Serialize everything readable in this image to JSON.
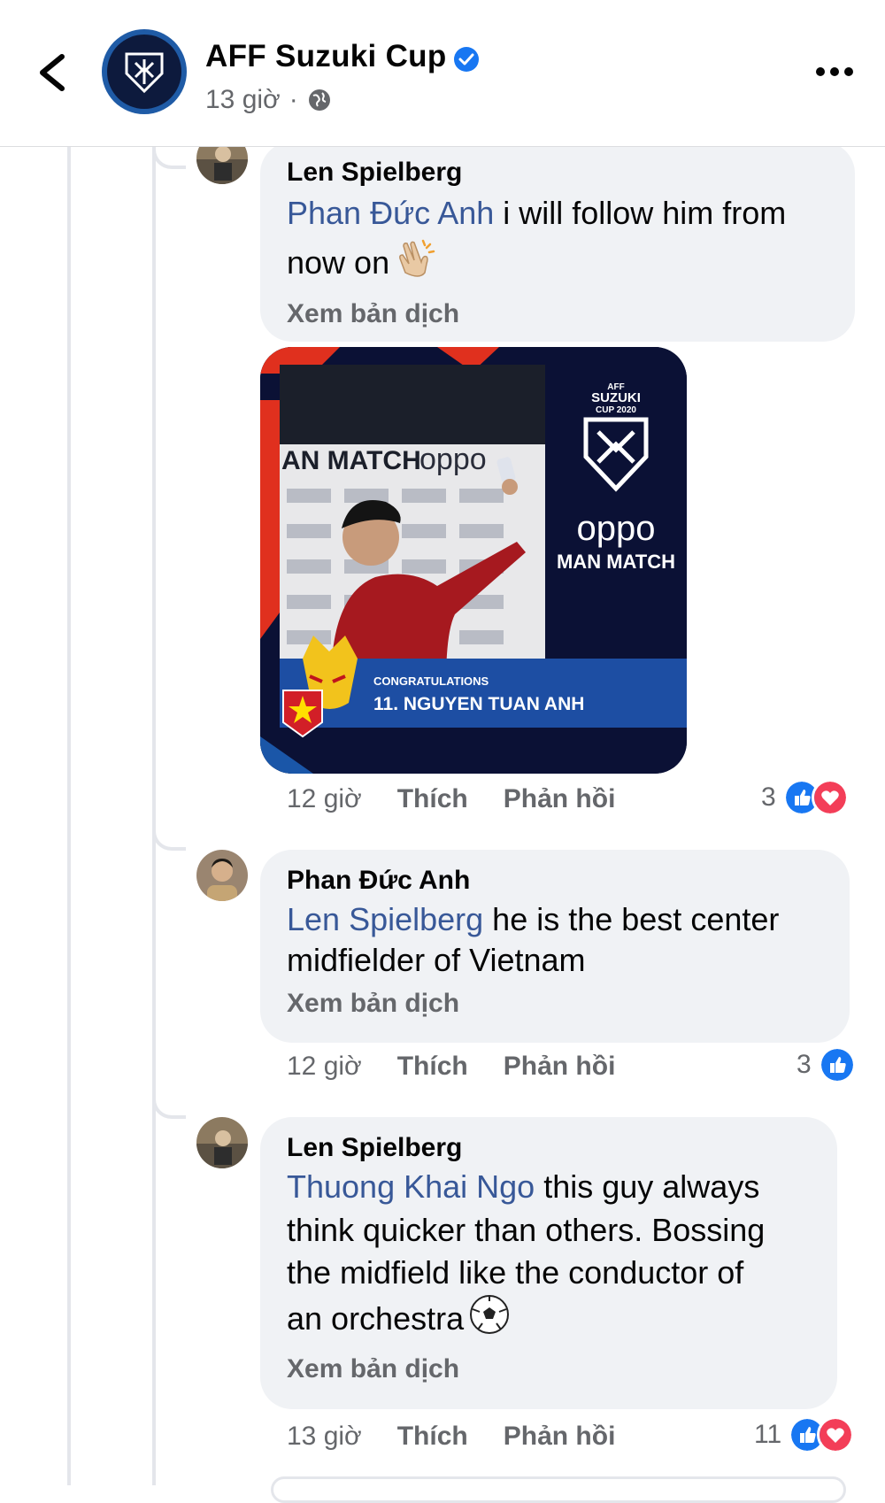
{
  "header": {
    "page_name": "AFF Suzuki Cup",
    "time": "13 giờ",
    "separator": "·"
  },
  "comments": [
    {
      "author": "Len Spielberg",
      "mention": "Phan Đức Anh",
      "text_line1": " i will follow him from",
      "text_line2": "now on",
      "translate": "Xem bản dịch",
      "time": "12 giờ",
      "like": "Thích",
      "reply": "Phản hồi",
      "reaction_count": "3"
    },
    {
      "author": "Phan Đức Anh",
      "mention": "Len Spielberg",
      "text_line1": " he is the best center",
      "text_line2": "midfielder of Vietnam",
      "translate": "Xem bản dịch",
      "time": "12 giờ",
      "like": "Thích",
      "reply": "Phản hồi",
      "reaction_count": "3"
    },
    {
      "author": "Len Spielberg",
      "mention": "Thuong Khai Ngo",
      "text_line1": " this guy always",
      "text_line2": "think quicker than others. Bossing",
      "text_line3": "the midfield like the conductor of",
      "text_line4": "an orchestra",
      "translate": "Xem bản dịch",
      "time": "13 giờ",
      "like": "Thích",
      "reply": "Phản hồi",
      "reaction_count": "11"
    }
  ],
  "media": {
    "backdrop_brand": "oppo",
    "backdrop_title": "AN MATCH",
    "logo_line1": "AFF",
    "logo_line2": "SUZUKI",
    "logo_line3": "CUP 2020",
    "sponsor": "oppo",
    "motm": "MAN MATCH",
    "congrats": "CONGRATULATIONS",
    "player": "11. NGUYEN TUAN ANH"
  },
  "colors": {
    "mention": "#385898",
    "like_blue": "#1877f2",
    "love_red": "#f33e58",
    "bubble": "#f0f2f5",
    "secondary_text": "#65676b"
  }
}
